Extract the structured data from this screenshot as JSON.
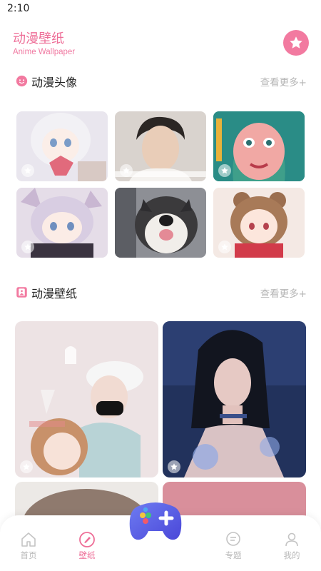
{
  "status_bar": {
    "time": "2:10"
  },
  "header": {
    "title": "动漫壁纸",
    "subtitle": "Anime Wallpaper",
    "star_icon": "star-icon",
    "accent": "#ee6f98"
  },
  "avatars_section": {
    "icon": "smile-face-icon",
    "title": "动漫头像",
    "more": "查看更多+"
  },
  "wallpapers_section": {
    "icon": "picture-icon",
    "title": "动漫壁纸",
    "more": "查看更多+"
  },
  "nav": {
    "items": [
      {
        "label": "首页",
        "icon": "home-icon"
      },
      {
        "label": "壁纸",
        "icon": "brush-icon",
        "active": true
      },
      {
        "label": "专题",
        "icon": "chat-bubble-icon"
      },
      {
        "label": "我的",
        "icon": "person-icon"
      }
    ],
    "center_icon": "gamepad-icon"
  }
}
